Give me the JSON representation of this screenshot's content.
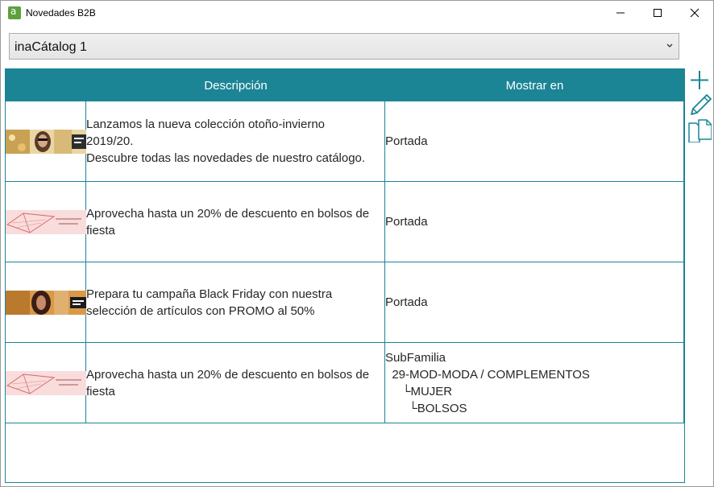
{
  "window": {
    "title": "Novedades B2B",
    "icon": "app-logo-icon"
  },
  "catalog_select": {
    "value": "inaCátalog 1"
  },
  "table": {
    "headers": {
      "description": "Descripción",
      "show_in": "Mostrar en"
    },
    "rows": [
      {
        "thumb": "fashion-banner-autumn",
        "description": "Lanzamos la nueva colección otoño-invierno\n2019/20.\nDescubre todas las novedades de nuestro catálogo.",
        "show_in": "Portada"
      },
      {
        "thumb": "pink-bags-banner",
        "description": "Aprovecha hasta un 20% de descuento en bolsos de\nfiesta",
        "show_in": "Portada"
      },
      {
        "thumb": "black-friday-banner",
        "description": "Prepara tu campaña Black Friday con nuestra\nselección de artículos con PROMO al 50%",
        "show_in": "Portada"
      },
      {
        "thumb": "pink-bags-banner",
        "description": "Aprovecha hasta un 20% de descuento en bolsos de\nfiesta",
        "show_in": "SubFamilia\n  29-MOD-MODA / COMPLEMENTOS\n     └MUJER\n       └BOLSOS"
      }
    ]
  },
  "toolbar": {
    "add": "plus-icon",
    "edit": "pencil-icon",
    "copy": "copy-icon"
  },
  "colors": {
    "accent": "#1b8595",
    "app_icon": "#5fa03c"
  }
}
